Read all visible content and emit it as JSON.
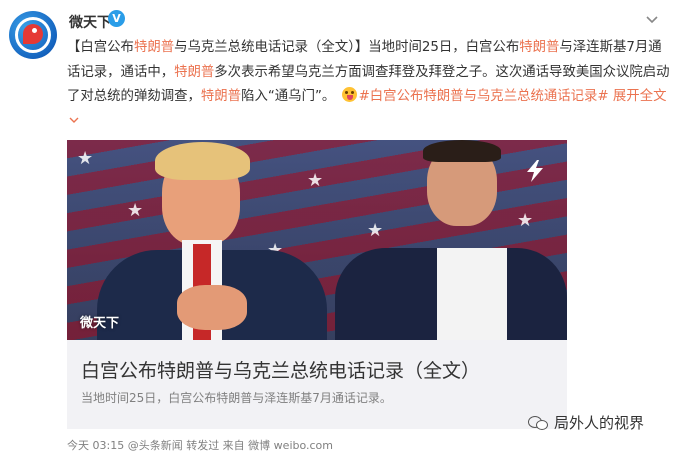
{
  "header": {
    "username": "微天下",
    "verified_badge": "V",
    "more_icon": "chevron-down-icon",
    "avatar_icon": "globe-bird-logo"
  },
  "post": {
    "p1": "【白宫公布",
    "h1": "特朗普",
    "p2": "与乌克兰总统电话记录（全文）】当地时间25日，白宫公布",
    "h2": "特朗普",
    "p3": "与泽连斯基7月通话记录，通话中，",
    "h3": "特朗普",
    "p4": "多次表示希望乌克兰方面调查拜登及拜登之子。这次通话导致美国众议院启动了对总统的弹劾调查，",
    "h4": "特朗普",
    "p5": "陷入“通乌门”。",
    "hashtag": "#白宫公布特朗普与乌克兰总统通话记录#",
    "expand": "展开全文",
    "expand_icon": "chevron-down-icon"
  },
  "card": {
    "source_label": "微天下",
    "title": "白宫公布特朗普与乌克兰总统电话记录（全文）",
    "subtitle": "当地时间25日，白宫公布特朗普与泽连斯基7月通话记录。",
    "icon": "lightning-icon"
  },
  "footer": {
    "meta": "今天 03:15 @头条新闻 转发过 来自 微博 weibo.com"
  },
  "watermark": {
    "text": "局外人的视界",
    "icon": "wechat-icon"
  },
  "colors": {
    "highlight": "#eb7350",
    "verified": "#2a9de8",
    "card_bg": "#f2f2f5"
  }
}
